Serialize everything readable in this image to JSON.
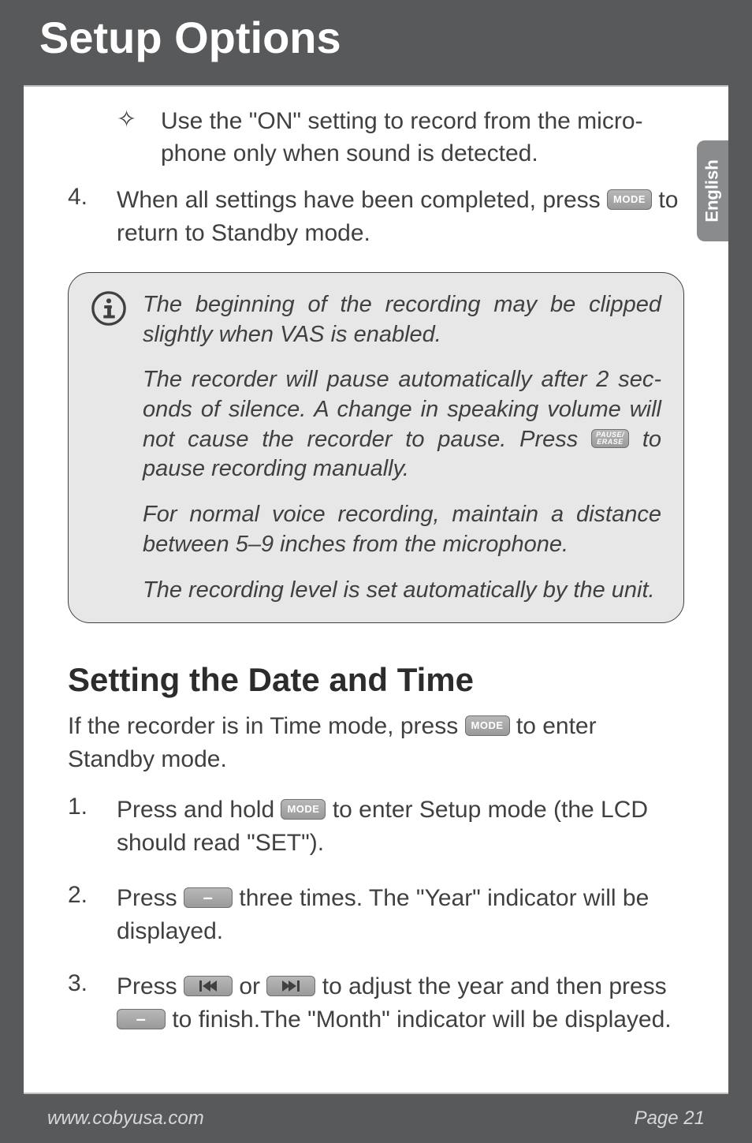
{
  "header": {
    "title": "Setup Options"
  },
  "side_tab": {
    "label": "English"
  },
  "bullet": {
    "marker": "✧",
    "text": "Use the \"ON\" setting to record from the micro­phone only when sound is detected."
  },
  "step4": {
    "num": "4.",
    "before": "When all settings have been completed, press ",
    "btn": "MODE",
    "after": " to return to Standby mode."
  },
  "info": {
    "p1": "The beginning of the recording may be clipped slightly when VAS is enabled.",
    "p2_before": "The recorder will pause automatically after 2 sec­onds of silence. A change in speaking volume will not cause the recorder to pause. Press ",
    "p2_btn_line1": "PAUSE/",
    "p2_btn_line2": "ERASE",
    "p2_after": " to pause recording manually.",
    "p3": "For normal voice recording, maintain a distance between 5–9 inches from the microphone.",
    "p4": "The recording level is set automatically by the unit."
  },
  "section": {
    "title": "Setting the Date and Time"
  },
  "intro": {
    "before": "If the recorder is in Time mode, press ",
    "btn": "MODE",
    "after": " to enter Standby mode."
  },
  "steps": {
    "s1": {
      "num": "1.",
      "before": "Press and hold ",
      "btn": "MODE",
      "after": " to enter Setup mode (the LCD should read \"SET\")."
    },
    "s2": {
      "num": "2.",
      "before": "Press ",
      "after": " three times. The \"Year\" indicator will be displayed."
    },
    "s3": {
      "num": "3.",
      "a": "Press ",
      "b": " or ",
      "c": " to adjust the year and then press ",
      "d": " to finish.The \"Month\" indicator will be displayed."
    }
  },
  "buttons": {
    "mode": "MODE",
    "minus": "–"
  },
  "footer": {
    "left": "www.cobyusa.com",
    "right": "Page 21"
  }
}
